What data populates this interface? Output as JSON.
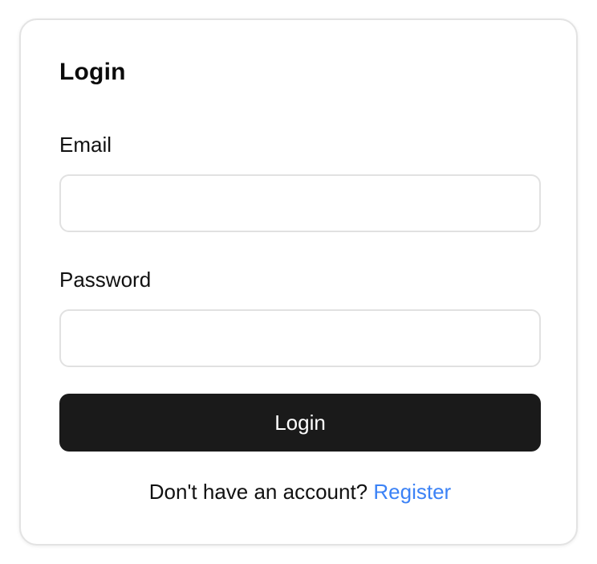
{
  "login_card": {
    "title": "Login",
    "email_label": "Email",
    "email_value": "",
    "email_placeholder": "",
    "password_label": "Password",
    "password_value": "",
    "password_placeholder": "",
    "submit_label": "Login",
    "footer_prompt": "Don't have an account?",
    "register_link_label": "Register"
  },
  "colors": {
    "button_bg": "#1a1a1a",
    "link": "#3b82f6",
    "border": "#e3e3e3"
  }
}
